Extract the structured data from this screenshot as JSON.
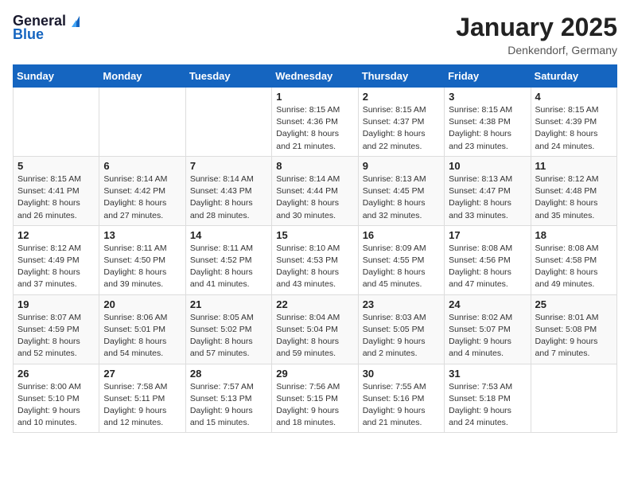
{
  "header": {
    "logo_general": "General",
    "logo_blue": "Blue",
    "month_year": "January 2025",
    "location": "Denkendorf, Germany"
  },
  "days_of_week": [
    "Sunday",
    "Monday",
    "Tuesday",
    "Wednesday",
    "Thursday",
    "Friday",
    "Saturday"
  ],
  "weeks": [
    [
      {
        "day": "",
        "info": ""
      },
      {
        "day": "",
        "info": ""
      },
      {
        "day": "",
        "info": ""
      },
      {
        "day": "1",
        "info": "Sunrise: 8:15 AM\nSunset: 4:36 PM\nDaylight: 8 hours\nand 21 minutes."
      },
      {
        "day": "2",
        "info": "Sunrise: 8:15 AM\nSunset: 4:37 PM\nDaylight: 8 hours\nand 22 minutes."
      },
      {
        "day": "3",
        "info": "Sunrise: 8:15 AM\nSunset: 4:38 PM\nDaylight: 8 hours\nand 23 minutes."
      },
      {
        "day": "4",
        "info": "Sunrise: 8:15 AM\nSunset: 4:39 PM\nDaylight: 8 hours\nand 24 minutes."
      }
    ],
    [
      {
        "day": "5",
        "info": "Sunrise: 8:15 AM\nSunset: 4:41 PM\nDaylight: 8 hours\nand 26 minutes."
      },
      {
        "day": "6",
        "info": "Sunrise: 8:14 AM\nSunset: 4:42 PM\nDaylight: 8 hours\nand 27 minutes."
      },
      {
        "day": "7",
        "info": "Sunrise: 8:14 AM\nSunset: 4:43 PM\nDaylight: 8 hours\nand 28 minutes."
      },
      {
        "day": "8",
        "info": "Sunrise: 8:14 AM\nSunset: 4:44 PM\nDaylight: 8 hours\nand 30 minutes."
      },
      {
        "day": "9",
        "info": "Sunrise: 8:13 AM\nSunset: 4:45 PM\nDaylight: 8 hours\nand 32 minutes."
      },
      {
        "day": "10",
        "info": "Sunrise: 8:13 AM\nSunset: 4:47 PM\nDaylight: 8 hours\nand 33 minutes."
      },
      {
        "day": "11",
        "info": "Sunrise: 8:12 AM\nSunset: 4:48 PM\nDaylight: 8 hours\nand 35 minutes."
      }
    ],
    [
      {
        "day": "12",
        "info": "Sunrise: 8:12 AM\nSunset: 4:49 PM\nDaylight: 8 hours\nand 37 minutes."
      },
      {
        "day": "13",
        "info": "Sunrise: 8:11 AM\nSunset: 4:50 PM\nDaylight: 8 hours\nand 39 minutes."
      },
      {
        "day": "14",
        "info": "Sunrise: 8:11 AM\nSunset: 4:52 PM\nDaylight: 8 hours\nand 41 minutes."
      },
      {
        "day": "15",
        "info": "Sunrise: 8:10 AM\nSunset: 4:53 PM\nDaylight: 8 hours\nand 43 minutes."
      },
      {
        "day": "16",
        "info": "Sunrise: 8:09 AM\nSunset: 4:55 PM\nDaylight: 8 hours\nand 45 minutes."
      },
      {
        "day": "17",
        "info": "Sunrise: 8:08 AM\nSunset: 4:56 PM\nDaylight: 8 hours\nand 47 minutes."
      },
      {
        "day": "18",
        "info": "Sunrise: 8:08 AM\nSunset: 4:58 PM\nDaylight: 8 hours\nand 49 minutes."
      }
    ],
    [
      {
        "day": "19",
        "info": "Sunrise: 8:07 AM\nSunset: 4:59 PM\nDaylight: 8 hours\nand 52 minutes."
      },
      {
        "day": "20",
        "info": "Sunrise: 8:06 AM\nSunset: 5:01 PM\nDaylight: 8 hours\nand 54 minutes."
      },
      {
        "day": "21",
        "info": "Sunrise: 8:05 AM\nSunset: 5:02 PM\nDaylight: 8 hours\nand 57 minutes."
      },
      {
        "day": "22",
        "info": "Sunrise: 8:04 AM\nSunset: 5:04 PM\nDaylight: 8 hours\nand 59 minutes."
      },
      {
        "day": "23",
        "info": "Sunrise: 8:03 AM\nSunset: 5:05 PM\nDaylight: 9 hours\nand 2 minutes."
      },
      {
        "day": "24",
        "info": "Sunrise: 8:02 AM\nSunset: 5:07 PM\nDaylight: 9 hours\nand 4 minutes."
      },
      {
        "day": "25",
        "info": "Sunrise: 8:01 AM\nSunset: 5:08 PM\nDaylight: 9 hours\nand 7 minutes."
      }
    ],
    [
      {
        "day": "26",
        "info": "Sunrise: 8:00 AM\nSunset: 5:10 PM\nDaylight: 9 hours\nand 10 minutes."
      },
      {
        "day": "27",
        "info": "Sunrise: 7:58 AM\nSunset: 5:11 PM\nDaylight: 9 hours\nand 12 minutes."
      },
      {
        "day": "28",
        "info": "Sunrise: 7:57 AM\nSunset: 5:13 PM\nDaylight: 9 hours\nand 15 minutes."
      },
      {
        "day": "29",
        "info": "Sunrise: 7:56 AM\nSunset: 5:15 PM\nDaylight: 9 hours\nand 18 minutes."
      },
      {
        "day": "30",
        "info": "Sunrise: 7:55 AM\nSunset: 5:16 PM\nDaylight: 9 hours\nand 21 minutes."
      },
      {
        "day": "31",
        "info": "Sunrise: 7:53 AM\nSunset: 5:18 PM\nDaylight: 9 hours\nand 24 minutes."
      },
      {
        "day": "",
        "info": ""
      }
    ]
  ]
}
